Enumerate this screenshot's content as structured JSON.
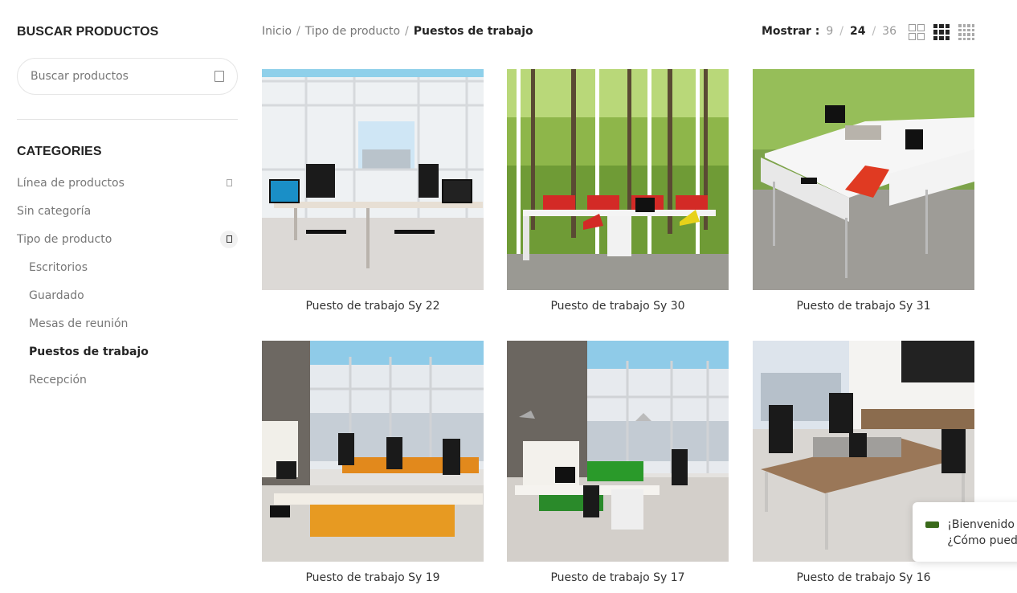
{
  "sidebar": {
    "search_title": "BUSCAR PRODUCTOS",
    "search_placeholder": "Buscar productos",
    "categories_title": "CATEGORIES",
    "categories": [
      {
        "label": "Línea de productos"
      },
      {
        "label": "Sin categoría"
      },
      {
        "label": "Tipo de producto"
      },
      {
        "label": "Escritorios"
      },
      {
        "label": "Guardado"
      },
      {
        "label": "Mesas de reunión"
      },
      {
        "label": "Puestos de trabajo"
      },
      {
        "label": "Recepción"
      }
    ]
  },
  "breadcrumb": {
    "home": "Inicio",
    "parent": "Tipo de producto",
    "current": "Puestos de trabajo",
    "sep": "/"
  },
  "show": {
    "label": "Mostrar :",
    "options": [
      "9",
      "24",
      "36"
    ],
    "selected": "24"
  },
  "products": [
    {
      "name": "Puesto de trabajo Sy 22"
    },
    {
      "name": "Puesto de trabajo Sy 30"
    },
    {
      "name": "Puesto de trabajo Sy 31"
    },
    {
      "name": "Puesto de trabajo Sy 19"
    },
    {
      "name": "Puesto de trabajo Sy 17"
    },
    {
      "name": "Puesto de trabajo Sy 16"
    }
  ],
  "chat": {
    "line1": "¡Bienvenido a",
    "line2": "¿Cómo pued"
  }
}
